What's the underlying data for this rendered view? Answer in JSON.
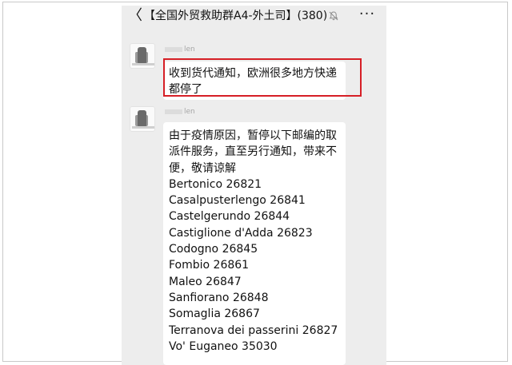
{
  "header": {
    "back_symbol": "〈",
    "title": "【全国外贸救助群A4-外土司】(380)",
    "mute_icon": "bell-off-icon",
    "more_symbol": "···"
  },
  "messages": [
    {
      "sender": "len",
      "text_lines": [
        "收到货代通知，欧洲很多地方快递",
        "都停了"
      ],
      "highlighted": true
    },
    {
      "sender": "len",
      "text_lines": [
        "由于疫情原因，暂停以下邮编的取",
        "派件服务，直至另行通知，带来不",
        "便，敬请谅解",
        "Bertonico 26821",
        "Casalpusterlengo 26841",
        "Castelgerundo 26844",
        "Castiglione d'Adda 26823",
        "Codogno 26845",
        "Fombio 26861",
        "Maleo 26847",
        "Sanfiorano 26848",
        "Somaglia 26867",
        "Terranova dei passerini 26827",
        "Vo' Euganeo 35030"
      ]
    }
  ],
  "colors": {
    "chat_bg": "#ededed",
    "bubble_bg": "#ffffff",
    "highlight_border": "#d61f26"
  }
}
